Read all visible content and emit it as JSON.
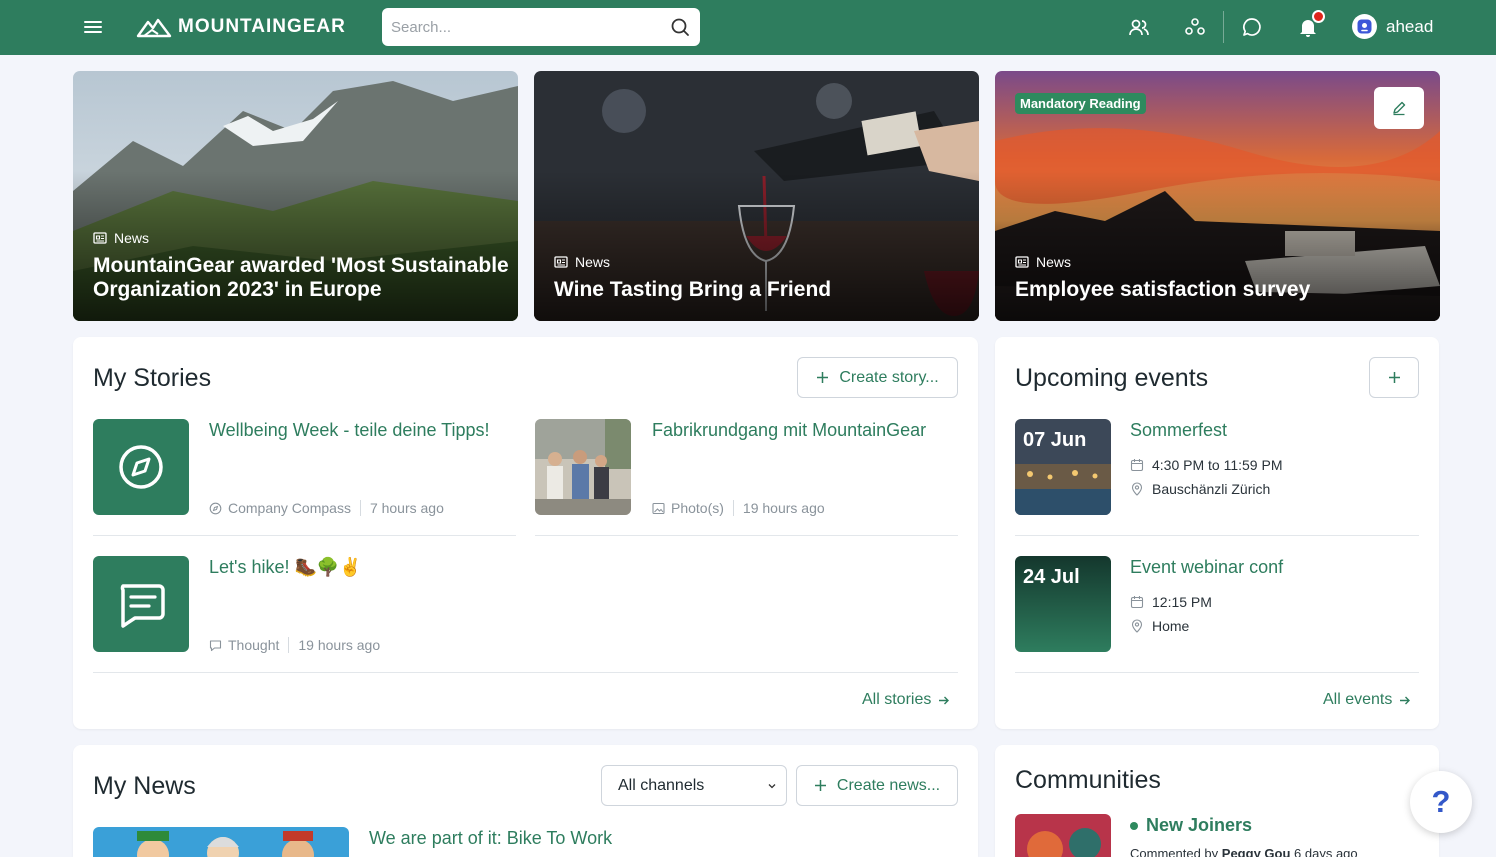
{
  "header": {
    "logo_text": "MOUNTAINGEAR",
    "search_placeholder": "Search...",
    "user_name": "ahead",
    "accent": "#2e7d5e"
  },
  "hero": [
    {
      "category": "News",
      "title": "MountainGear awarded 'Most Sustainable Organization 2023' in Europe"
    },
    {
      "category": "News",
      "title": "Wine Tasting Bring a Friend"
    },
    {
      "category": "News",
      "title": "Employee satisfaction survey",
      "badge": "Mandatory Reading"
    }
  ],
  "stories": {
    "title": "My Stories",
    "create_label": "Create story...",
    "all_label": "All stories",
    "items": [
      {
        "title": "Wellbeing Week - teile deine Tipps!",
        "type": "Company Compass",
        "time": "7 hours ago",
        "icon": "compass-icon"
      },
      {
        "title": "Fabrikrundgang mit MountainGear",
        "type": "Photo(s)",
        "time": "19 hours ago",
        "icon": "photo-icon"
      },
      {
        "title": "Let's hike! 🥾🌳✌️",
        "type": "Thought",
        "time": "19 hours ago",
        "icon": "chat-icon"
      }
    ]
  },
  "events": {
    "title": "Upcoming events",
    "all_label": "All events",
    "items": [
      {
        "date": "07 Jun",
        "title": "Sommerfest",
        "time": "4:30 PM to 11:59 PM",
        "location": "Bauschänzli Zürich"
      },
      {
        "date": "24 Jul",
        "title": "Event webinar conf",
        "time": "12:15 PM",
        "location": "Home"
      }
    ]
  },
  "news": {
    "title": "My News",
    "channel_selected": "All channels",
    "create_label": "Create news...",
    "first_item_title": "We are part of it: Bike To Work"
  },
  "communities": {
    "title": "Communities",
    "first_name": "New Joiners",
    "first_meta_prefix": "Commented by",
    "first_meta_user": "Peggy Gou",
    "first_meta_time": "6 days ago"
  },
  "help_label": "?"
}
